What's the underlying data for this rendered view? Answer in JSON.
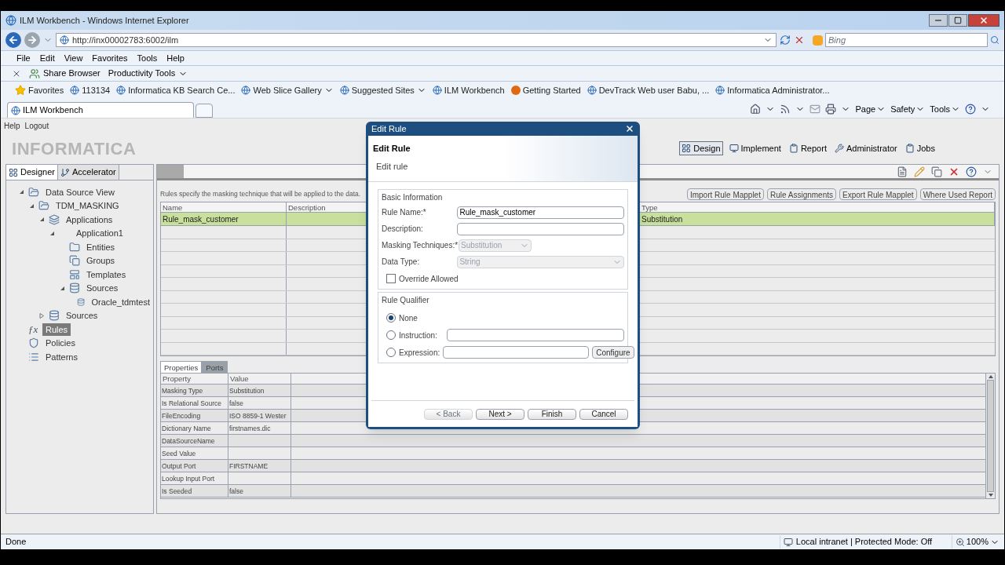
{
  "window": {
    "title": "ILM Workbench - Windows Internet Explorer"
  },
  "address_bar": {
    "value": "http://inx00002783:6002/ilm"
  },
  "search": {
    "placeholder": "Bing"
  },
  "menu": [
    "File",
    "Edit",
    "View",
    "Favorites",
    "Tools",
    "Help"
  ],
  "toolbar": {
    "items": [
      "Share Browser",
      "Productivity Tools"
    ]
  },
  "favorites_bar": [
    {
      "label": "Favorites",
      "kind": "favorites"
    },
    {
      "label": "113134",
      "kind": "page"
    },
    {
      "label": "Informatica KB Search Ce...",
      "kind": "page"
    },
    {
      "label": "Web Slice Gallery",
      "kind": "menu"
    },
    {
      "label": "Suggested Sites",
      "kind": "menu"
    },
    {
      "label": "ILM Workbench",
      "kind": "page"
    },
    {
      "label": "Getting Started",
      "kind": "fox"
    },
    {
      "label": "DevTrack Web user Babu, ...",
      "kind": "page"
    },
    {
      "label": "Informatica Administrator...",
      "kind": "page"
    }
  ],
  "browser_tabs": [
    {
      "label": "ILM Workbench",
      "selected": true
    }
  ],
  "command_bar": [
    "Page",
    "Safety",
    "Tools"
  ],
  "app": {
    "links": [
      "Help",
      "Logout"
    ],
    "logo": "INFORMATICA",
    "nav": [
      {
        "label": "Design",
        "selected": true,
        "kind": "design"
      },
      {
        "label": "Implement",
        "selected": false,
        "kind": "implement"
      },
      {
        "label": "Report",
        "selected": false,
        "kind": "report"
      },
      {
        "label": "Administrator",
        "selected": false,
        "kind": "admin"
      },
      {
        "label": "Jobs",
        "selected": false,
        "kind": "report"
      }
    ]
  },
  "left_panel": {
    "tabs": [
      {
        "label": "Designer",
        "selected": true
      },
      {
        "label": "Accelerator",
        "selected": false
      }
    ],
    "tree": [
      {
        "label": "Data Source View",
        "kind": "folder",
        "expanded": true,
        "selected": false,
        "children": [
          {
            "label": "TDM_MASKING",
            "kind": "folder",
            "expanded": true,
            "selected": false,
            "children": [
              {
                "label": "Applications",
                "kind": "application",
                "expanded": true,
                "selected": false,
                "children": [
                  {
                    "label": "Application1",
                    "expanded": true,
                    "selected": false,
                    "children": [
                      {
                        "label": "Entities",
                        "kind": "entity",
                        "selected": false
                      },
                      {
                        "label": "Groups",
                        "kind": "group",
                        "selected": false
                      },
                      {
                        "label": "Templates",
                        "kind": "template",
                        "selected": false
                      },
                      {
                        "label": "Sources",
                        "kind": "source",
                        "expanded": true,
                        "selected": false,
                        "children": [
                          {
                            "label": "Oracle_tdmtest",
                            "kind": "source",
                            "selected": false
                          }
                        ]
                      }
                    ]
                  }
                ]
              },
              {
                "label": "Sources",
                "kind": "source",
                "expanded": false,
                "selected": false
              }
            ]
          }
        ]
      },
      {
        "label": "Rules",
        "kind": "rule",
        "symbol": "ƒx",
        "selected": true
      },
      {
        "label": "Policies",
        "kind": "policy",
        "selected": false
      },
      {
        "label": "Patterns",
        "kind": "pattern",
        "selected": false
      }
    ]
  },
  "rules_panel": {
    "description": "Rules specify the masking technique that will be applied to the data.",
    "buttons": [
      "Import Rule Mapplet",
      "Rule Assignments",
      "Export Rule Mapplet",
      "Where Used Report"
    ],
    "columns": [
      "Name",
      "Description",
      "Type"
    ],
    "rows": [
      {
        "cells": [
          "Rule_mask_customer",
          "",
          "Substitution"
        ],
        "selected": true
      }
    ]
  },
  "properties_panel": {
    "tabs": [
      {
        "label": "Properties",
        "selected": true
      },
      {
        "label": "Ports",
        "selected": false
      }
    ],
    "columns": [
      "Property",
      "Value"
    ],
    "rows": [
      [
        "Masking Type",
        "Substitution"
      ],
      [
        "Is Relational Source",
        "false"
      ],
      [
        "FileEncoding",
        "ISO 8859-1 Wester"
      ],
      [
        "Dictionary Name",
        "firstnames.dic"
      ],
      [
        "DataSourceName",
        ""
      ],
      [
        "Seed Value",
        ""
      ],
      [
        "Output Port",
        "FIRSTNAME"
      ],
      [
        "Lookup Input Port",
        ""
      ],
      [
        "Is Seeded",
        "false"
      ]
    ]
  },
  "dialog": {
    "title": "Edit Rule",
    "heading": "Edit Rule",
    "subheading": "Edit rule",
    "basic": {
      "title": "Basic Information",
      "fields": [
        {
          "kind": "text",
          "label": "Rule Name:*",
          "value": "Rule_mask_customer"
        },
        {
          "kind": "text",
          "label": "Description:"
        },
        {
          "kind": "select",
          "label": "Masking Techniques:*",
          "value": "Substitution",
          "disabled": true
        },
        {
          "kind": "wideselect",
          "label": "Data Type:",
          "value": "String",
          "disabled": true
        },
        {
          "kind": "checkbox",
          "label": "Override Allowed",
          "checked": false
        }
      ]
    },
    "qualifier": {
      "title": "Rule Qualifier",
      "options": [
        {
          "label": "None",
          "selected": true,
          "kind": "plain"
        },
        {
          "label": "Instruction:",
          "selected": false,
          "kind": "field"
        },
        {
          "label": "Expression:",
          "selected": false,
          "kind": "configure",
          "button": "Configure"
        }
      ]
    },
    "buttons": [
      {
        "label": "< Back",
        "disabled": true
      },
      {
        "label": "Next >",
        "disabled": false
      },
      {
        "label": "Finish",
        "disabled": false
      },
      {
        "label": "Cancel",
        "disabled": false
      }
    ]
  },
  "status_bar": {
    "text": "Done",
    "zone": "Local intranet | Protected Mode: Off",
    "zoom": "100%"
  }
}
